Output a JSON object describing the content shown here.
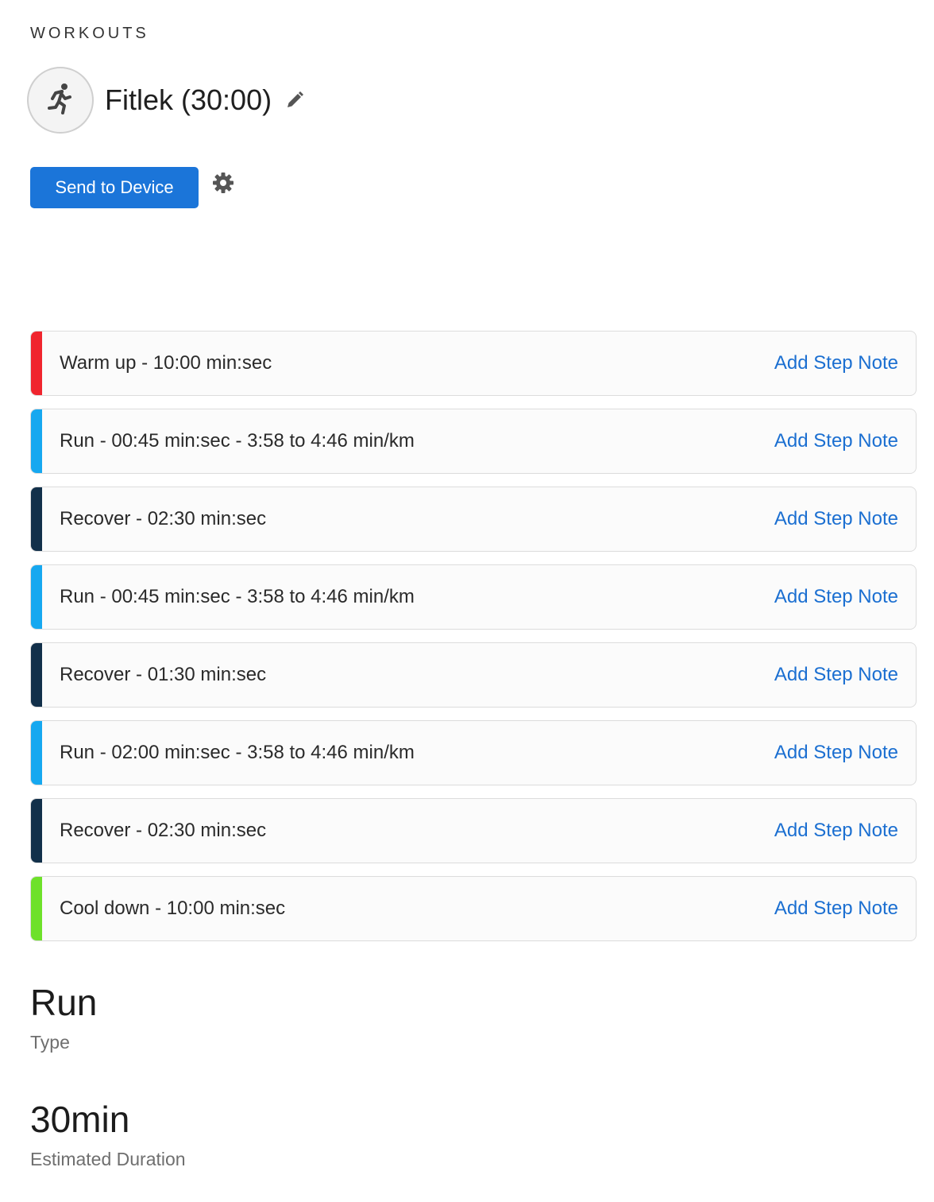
{
  "breadcrumb": "WORKOUTS",
  "workout": {
    "title": "Fitlek (30:00)",
    "avatar_icon": "running-person-icon",
    "edit_icon": "pencil-icon"
  },
  "actions": {
    "send_label": "Send to Device",
    "settings_icon": "gear-icon"
  },
  "steps": [
    {
      "text": "Warm up - 10:00 min:sec",
      "note": "Add Step Note",
      "color": "#f0252e"
    },
    {
      "text": "Run - 00:45 min:sec - 3:58 to 4:46 min/km",
      "note": "Add Step Note",
      "color": "#16a8f0"
    },
    {
      "text": "Recover - 02:30 min:sec",
      "note": "Add Step Note",
      "color": "#12304a"
    },
    {
      "text": "Run - 00:45 min:sec - 3:58 to 4:46 min/km",
      "note": "Add Step Note",
      "color": "#16a8f0"
    },
    {
      "text": "Recover - 01:30 min:sec",
      "note": "Add Step Note",
      "color": "#12304a"
    },
    {
      "text": "Run - 02:00 min:sec - 3:58 to 4:46 min/km",
      "note": "Add Step Note",
      "color": "#16a8f0"
    },
    {
      "text": "Recover - 02:30 min:sec",
      "note": "Add Step Note",
      "color": "#12304a"
    },
    {
      "text": "Cool down - 10:00 min:sec",
      "note": "Add Step Note",
      "color": "#6ee12a"
    }
  ],
  "stats": {
    "type_value": "Run",
    "type_label": "Type",
    "duration_value": "30min",
    "duration_label": "Estimated Duration"
  },
  "colors": {
    "accent": "#1b75d9",
    "link": "#1b6fd1"
  }
}
